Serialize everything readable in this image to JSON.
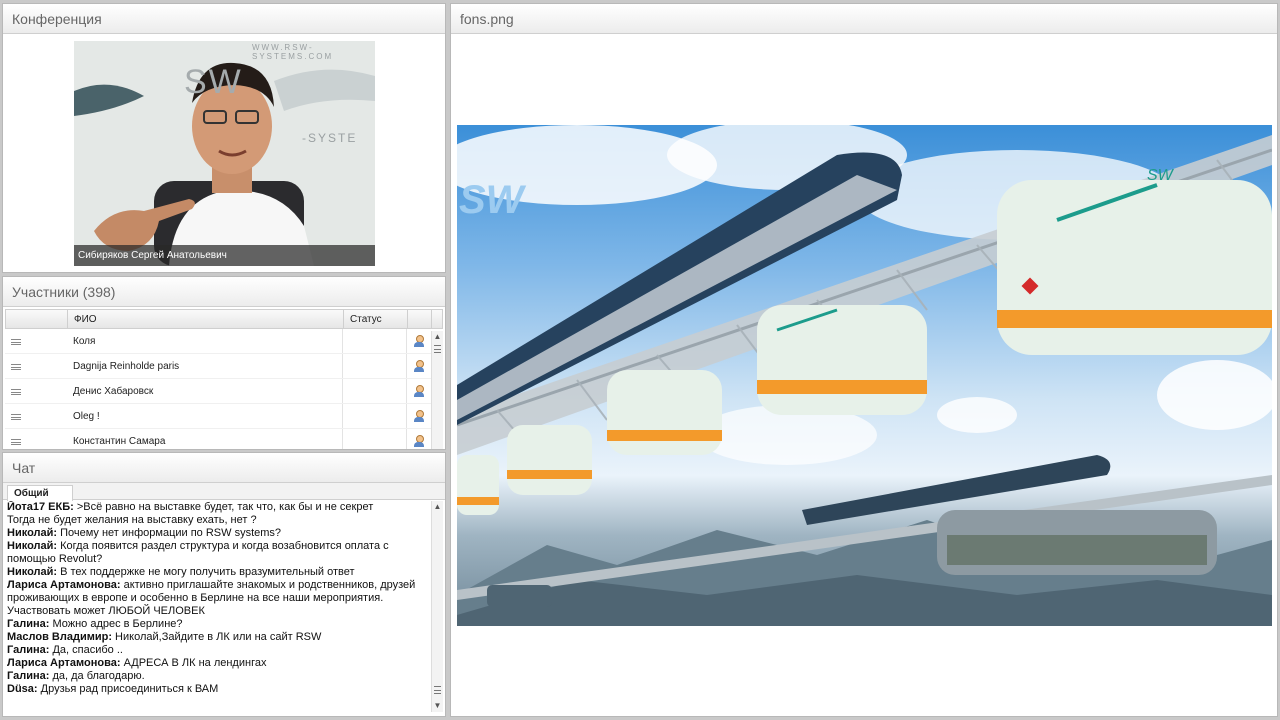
{
  "conference": {
    "title": "Конференция",
    "speaker_name": "Сибиряков Сергей  Анатольевич",
    "banner_text": [
      "WWW.RSW-SYSTEMS.COM",
      "SW",
      "-SYSTE"
    ]
  },
  "participants": {
    "title": "Участники (398)",
    "columns": [
      "ФИО",
      "Статус"
    ],
    "rows": [
      {
        "name": "Коля"
      },
      {
        "name": "Dagnija Reinholde paris"
      },
      {
        "name": "Денис Хабаровск"
      },
      {
        "name": "Oleg !"
      },
      {
        "name": "Константин Самара"
      }
    ]
  },
  "chat": {
    "title": "Чат",
    "tab": "Общий",
    "messages": [
      {
        "author": "Йота17 ЕКБ:",
        "text": " >Всё равно на выставке будет, так что, как бы и не секрет"
      },
      {
        "author": "",
        "text": "Тогда не будет желания на выставку ехать, нет ?"
      },
      {
        "author": "Николай:",
        "text": " Почему нет информации по RSW systems?"
      },
      {
        "author": "Николай:",
        "text": "  Когда появится раздел структура и  когда возабновится оплата с помощью Revolut?"
      },
      {
        "author": "Николай:",
        "text": " В тех поддержке не могу получить вразумительный ответ"
      },
      {
        "author": "Лариса Артамонова:",
        "text": " активно приглашайте знакомых и родственников, друзей проживающих в европе и особенно в Берлине на все наши мероприятия. Участвовать может ЛЮБОЙ ЧЕЛОВЕК"
      },
      {
        "author": "Галина:",
        "text": " Можно адрес в Берлине?"
      },
      {
        "author": "Маслов Владимир:",
        "text": " Николай,Зайдите в ЛК или на сайт RSW"
      },
      {
        "author": "Галина:",
        "text": " Да, спасибо .."
      },
      {
        "author": "Лариса Артамонова:",
        "text": " АДРЕСА В ЛК на лендингах"
      },
      {
        "author": "Галина:",
        "text": " да, да  благодарю."
      },
      {
        "author": "Düsa:",
        "text": " Друзья рад присоединиться к ВАМ"
      }
    ]
  },
  "presentation": {
    "title": "fons.png",
    "logo_text": "SW",
    "car_logo": "SW"
  },
  "colors": {
    "accent_orange": "#f39a2b",
    "cabin_body": "#e7f1e9",
    "teal_stripe": "#1c9c8c",
    "truss": "#b9c2c8"
  }
}
